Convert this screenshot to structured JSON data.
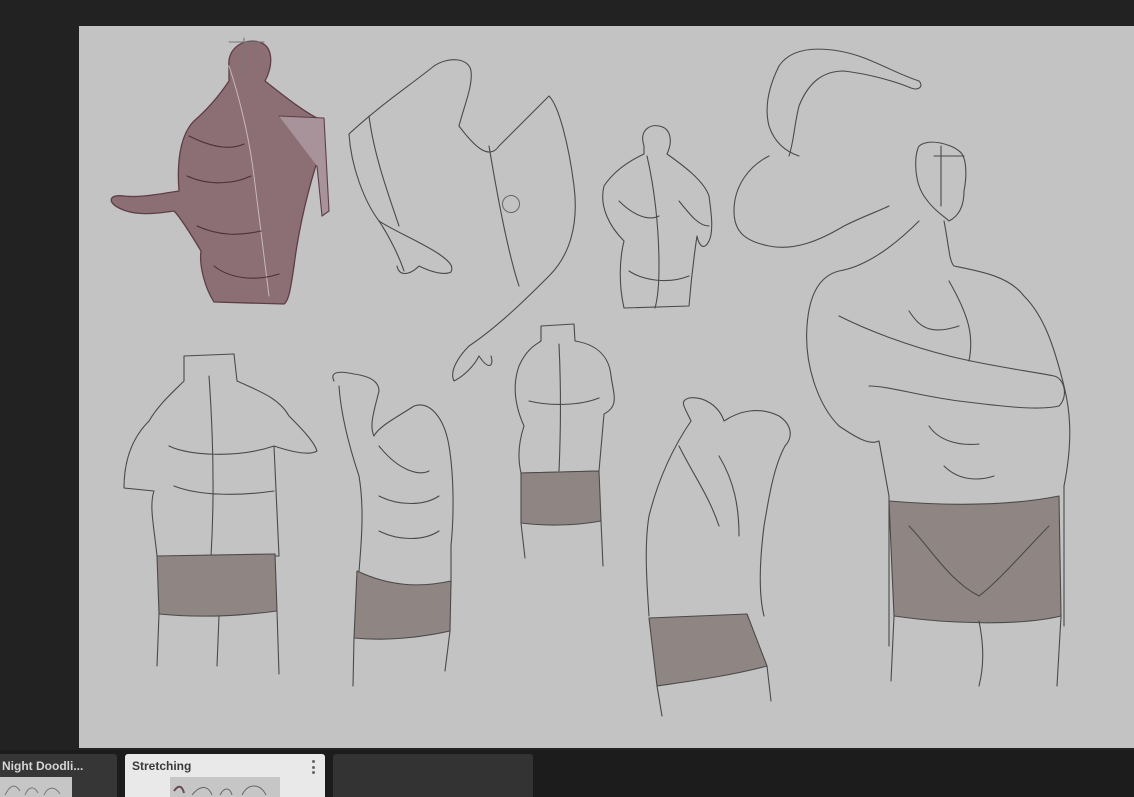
{
  "tabs": [
    {
      "label": "Night Doodli...",
      "active": false
    },
    {
      "label": "Stretching",
      "active": true
    },
    {
      "label": "",
      "active": false
    }
  ],
  "icons": {
    "tab_menu": "vertical-dots-icon",
    "cursor": "brush-cursor-icon"
  },
  "colors": {
    "workspace": "#222222",
    "canvas": "#c3c3c3",
    "sketch_line": "#4a4a4a",
    "shorts_fill": "#8f8684",
    "rendered_torso": "#7d5a61",
    "active_tab": "#e9e9e9"
  }
}
